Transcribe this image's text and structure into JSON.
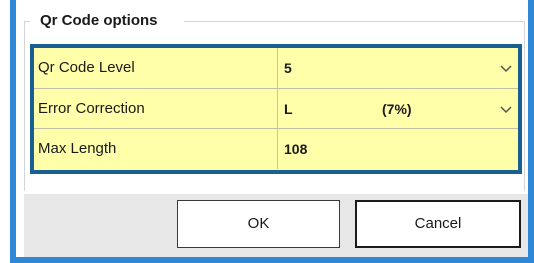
{
  "group": {
    "title": "Qr Code options"
  },
  "rows": [
    {
      "label": "Qr Code Level",
      "value": "5",
      "percent": "",
      "has_dropdown": true
    },
    {
      "label": "Error Correction",
      "value": "L",
      "percent": "(7%)",
      "has_dropdown": true
    },
    {
      "label": "Max Length",
      "value": "108",
      "percent": "",
      "has_dropdown": false
    }
  ],
  "buttons": {
    "ok": "OK",
    "cancel": "Cancel"
  },
  "colors": {
    "window_border": "#2f87d8",
    "grid_border": "#1a5f92",
    "grid_background": "#ffffaa",
    "button_bar": "#e7e7e7"
  },
  "icons": {
    "dropdown": "chevron-down-icon"
  }
}
